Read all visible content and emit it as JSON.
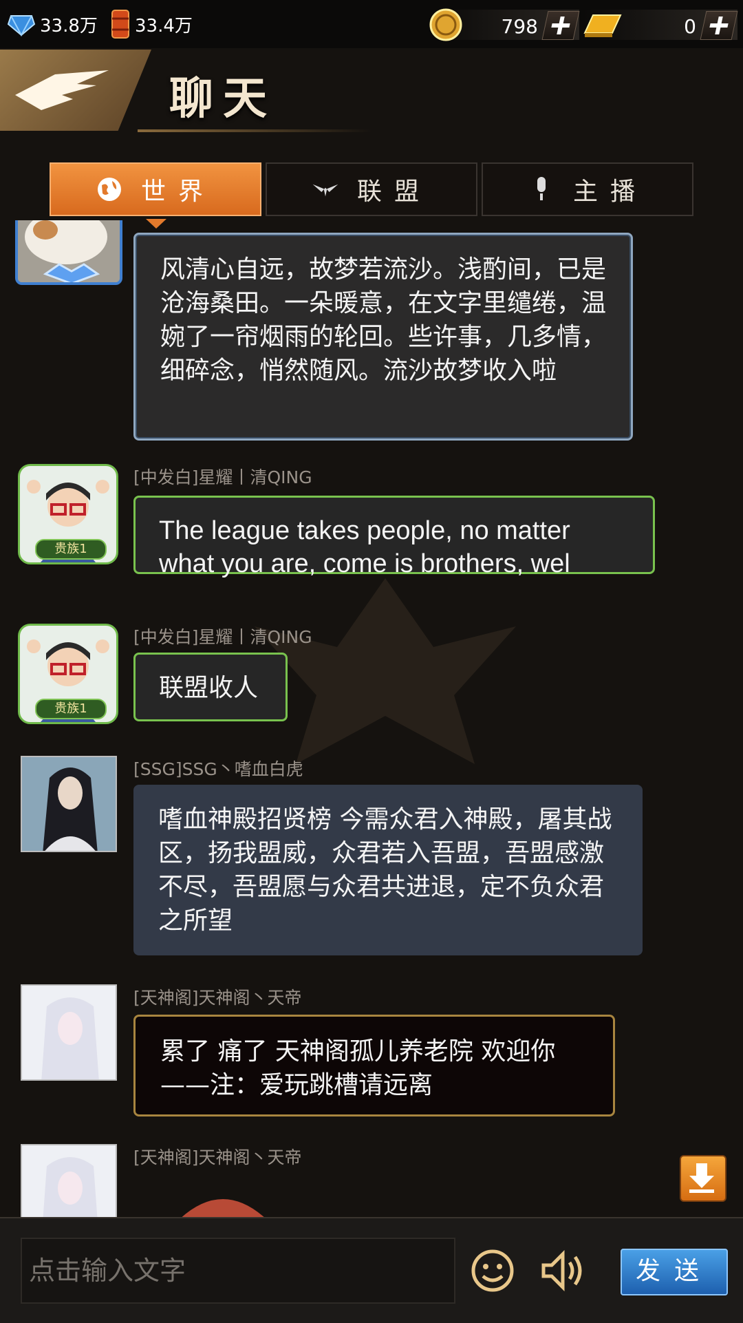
{
  "resources": {
    "crystal": "33.8万",
    "oil": "33.4万",
    "coins": "798",
    "gold": "0"
  },
  "header": {
    "title": "聊天"
  },
  "tabs": [
    {
      "label": "世界",
      "icon": "globe-icon",
      "active": true
    },
    {
      "label": "联盟",
      "icon": "alliance-wings-icon",
      "active": false
    },
    {
      "label": "主播",
      "icon": "microphone-icon",
      "active": false
    }
  ],
  "messages": [
    {
      "sender": "",
      "text": "风清心自远，故梦若流沙。浅酌间，已是沧海桑田。一朵暖意，在文字里缱绻，温婉了一帘烟雨的轮回。些许事，几多情，细碎念，悄然随风。流沙故梦收入啦"
    },
    {
      "sender": "[中发白]星耀丨清QING",
      "badge": "贵族1",
      "text": "The league takes people, no matter what you are, come is brothers, wel"
    },
    {
      "sender": "[中发白]星耀丨清QING",
      "badge": "贵族1",
      "text": "联盟收人"
    },
    {
      "sender": "[SSG]SSG丶嗜血白虎",
      "text": "嗜血神殿招贤榜 今需众君入神殿，屠其战区，扬我盟威，众君若入吾盟，吾盟感激不尽，吾盟愿与众君共进退，定不负众君之所望"
    },
    {
      "sender": "[天神阁]天神阁丶天帝",
      "text": "累了 痛了 天神阁孤儿养老院 欢迎你——注：爱玩跳槽请远离"
    },
    {
      "sender": "[天神阁]天神阁丶天帝",
      "text": ""
    }
  ],
  "input": {
    "placeholder": "点击输入文字"
  },
  "send": {
    "label": "发送"
  },
  "colors": {
    "accent_orange": "#e8782a",
    "send_blue": "#2f7fd0"
  }
}
